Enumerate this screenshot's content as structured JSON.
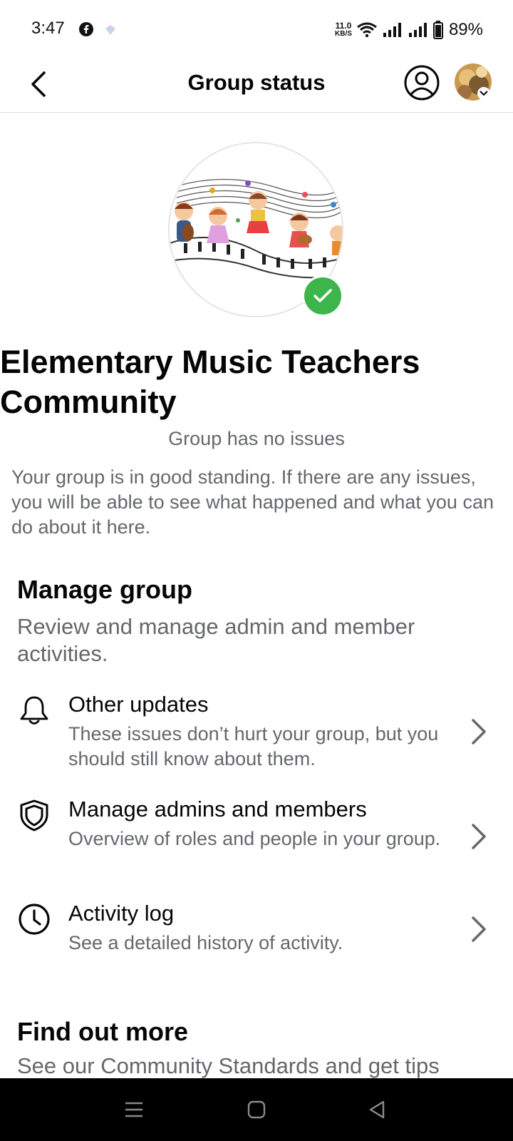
{
  "status_bar": {
    "time": "3:47",
    "speed_value": "11.0",
    "speed_unit": "KB/S",
    "battery": "89%"
  },
  "header": {
    "title": "Group status"
  },
  "group": {
    "name": "Elementary Music Teachers Community",
    "status": "Group has no issues",
    "description": "Your group is in good standing. If there are any issues, you will be able to see what happened and what you can do about it here."
  },
  "manage": {
    "title": "Manage group",
    "subtitle": "Review and manage admin and member activities.",
    "items": [
      {
        "icon": "bell-icon",
        "title": "Other updates",
        "description": "These issues don’t hurt your group, but you should still know about them."
      },
      {
        "icon": "shield-icon",
        "title": "Manage admins and members",
        "description": "Overview of roles and people in your group."
      },
      {
        "icon": "clock-icon",
        "title": "Activity log",
        "description": "See a detailed history of activity."
      }
    ]
  },
  "find_out_more": {
    "title": "Find out more",
    "subtitle": "See our Community Standards and get tips"
  },
  "colors": {
    "badge_green": "#3db54a",
    "secondary_text": "#65676b"
  }
}
